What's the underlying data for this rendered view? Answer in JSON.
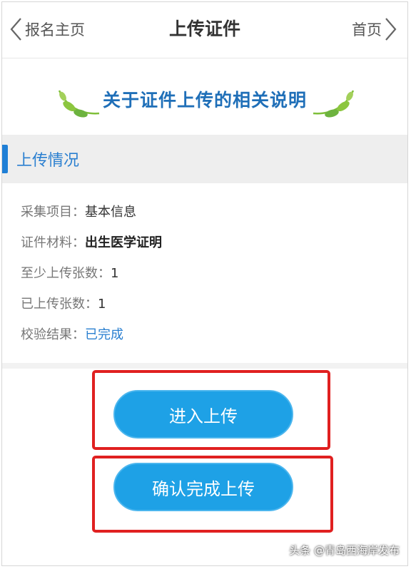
{
  "header": {
    "back_label": "报名主页",
    "title": "上传证件",
    "home_label": "首页"
  },
  "banner": {
    "title": "关于证件上传的相关说明"
  },
  "section": {
    "title": "上传情况"
  },
  "info": [
    {
      "label": "采集项目：",
      "value": "基本信息"
    },
    {
      "label": "证件材料：",
      "value": "出生医学证明"
    },
    {
      "label": "至少上传张数：",
      "value": "1"
    },
    {
      "label": "已上传张数：",
      "value": "1"
    },
    {
      "label": "校验结果：",
      "value": "已完成"
    }
  ],
  "buttons": {
    "enter_upload": "进入上传",
    "confirm_upload": "确认完成上传"
  },
  "watermark": "头条 @青岛西海岸发布",
  "colors": {
    "accent": "#1f7fd6",
    "button": "#1ea1e6",
    "highlight": "#e02020",
    "status_link": "#2a7fd0"
  }
}
